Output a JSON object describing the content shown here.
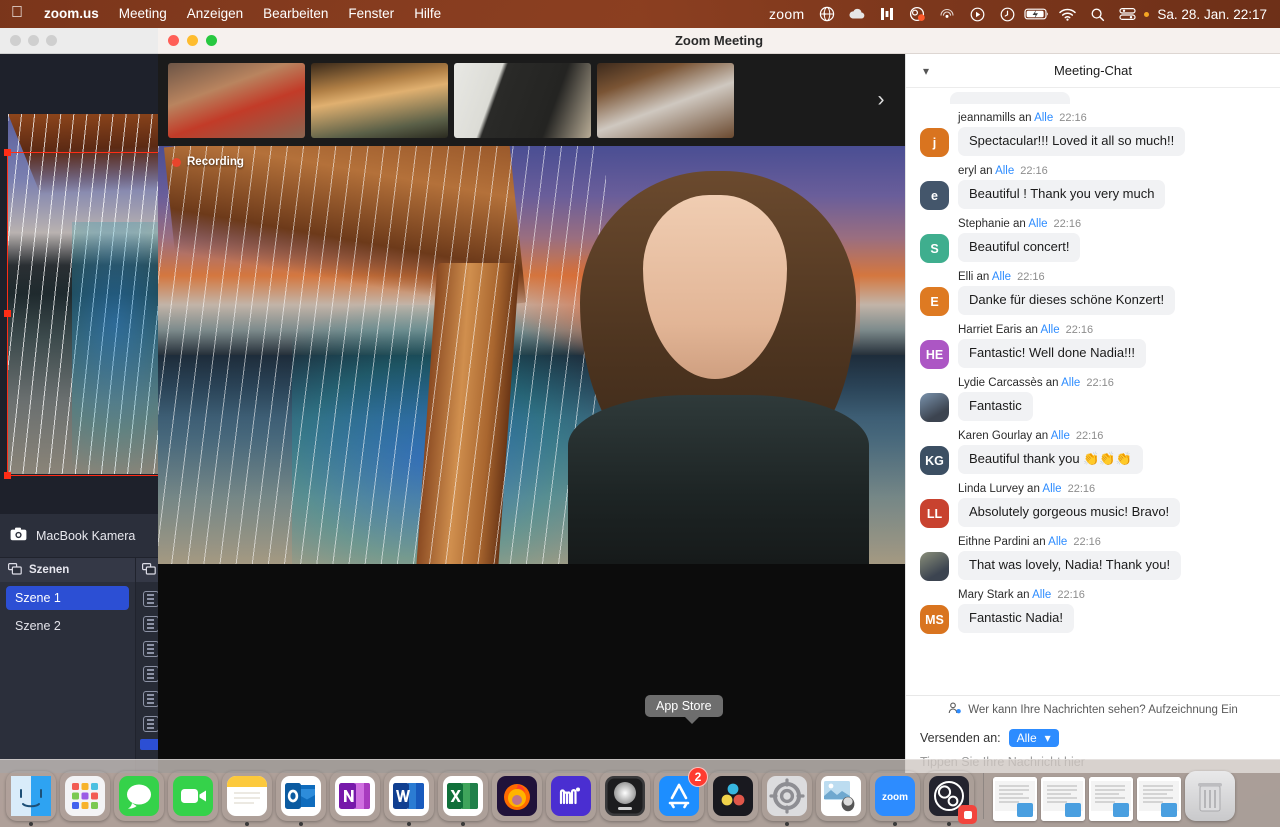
{
  "menubar": {
    "apple_icon": "apple-logo",
    "app_name": "zoom.us",
    "items": [
      "Meeting",
      "Anzeigen",
      "Bearbeiten",
      "Fenster",
      "Hilfe"
    ],
    "status_zoom_label": "zoom",
    "status_icons": [
      "globe-icon",
      "cloud-icon",
      "bars-icon",
      "obs-record-icon",
      "airplay-icon",
      "play-circle-icon",
      "clock-icon",
      "battery-charging-icon",
      "wifi-icon",
      "control-center-icon"
    ],
    "status_dot": "orange-dot",
    "search_icon": "search-icon",
    "clock": "Sa. 28. Jan.  22:17"
  },
  "obs_window": {
    "window_controls": [
      "close",
      "minimize",
      "zoom"
    ],
    "camera_source_label": "MacBook Kamera",
    "camera_icon": "camera-icon",
    "scenes_panel": {
      "title": "Szenen",
      "icon": "scenes-icon",
      "items": [
        {
          "label": "Szene 1",
          "selected": true
        },
        {
          "label": "Szene 2",
          "selected": false
        }
      ]
    },
    "sources_panel": {
      "icon": "sources-icon",
      "item_count": 6
    }
  },
  "zoom_window": {
    "title": "Zoom Meeting",
    "window_controls": [
      "close",
      "minimize",
      "zoom"
    ],
    "thumbnails": [
      {
        "name": "participant-thumb-1"
      },
      {
        "name": "participant-thumb-2"
      },
      {
        "name": "participant-thumb-3"
      },
      {
        "name": "participant-thumb-4"
      }
    ],
    "thumb_next_icon": "chevron-right-icon",
    "recording_label": "Recording",
    "speaker": {
      "name": "active-speaker-video",
      "description": "harpist"
    }
  },
  "chat": {
    "title": "Meeting-Chat",
    "collapse_icon": "chevron-down-icon",
    "to_word": "an",
    "messages": [
      {
        "sender": "jeannamills",
        "to": "Alle",
        "time": "22:16",
        "text": "Spectacular!!! Loved it all so much!!",
        "initials": "j",
        "color": "#d9741f",
        "photo": false
      },
      {
        "sender": "eryl",
        "to": "Alle",
        "time": "22:16",
        "text": "Beautiful ! Thank you very much",
        "initials": "e",
        "color": "#44566b",
        "photo": false
      },
      {
        "sender": "Stephanie",
        "to": "Alle",
        "time": "22:16",
        "text": "Beautiful concert!",
        "initials": "S",
        "color": "#3fae8e",
        "photo": false
      },
      {
        "sender": "Elli",
        "to": "Alle",
        "time": "22:16",
        "text": "Danke für dieses schöne Konzert!",
        "initials": "E",
        "color": "#de7a22",
        "photo": false
      },
      {
        "sender": "Harriet Earis",
        "to": "Alle",
        "time": "22:16",
        "text": "Fantastic! Well done Nadia!!!",
        "initials": "HE",
        "color": "#ac56c4",
        "photo": false
      },
      {
        "sender": "Lydie Carcassès",
        "to": "Alle",
        "time": "22:16",
        "text": "Fantastic",
        "initials": "",
        "color": "#7a93ad",
        "photo": true
      },
      {
        "sender": "Karen Gourlay",
        "to": "Alle",
        "time": "22:16",
        "text": "Beautiful thank you 👏👏👏",
        "initials": "KG",
        "color": "#3c4f63",
        "photo": false
      },
      {
        "sender": "Linda Lurvey",
        "to": "Alle",
        "time": "22:16",
        "text": "Absolutely gorgeous music! Bravo!",
        "initials": "LL",
        "color": "#c8422f",
        "photo": false
      },
      {
        "sender": "Eithne Pardini",
        "to": "Alle",
        "time": "22:16",
        "text": "That was lovely, Nadia! Thank you!",
        "initials": "",
        "color": "#8a8f7a",
        "photo": true
      },
      {
        "sender": "Mary Stark",
        "to": "Alle",
        "time": "22:16",
        "text": "Fantastic Nadia!",
        "initials": "MS",
        "color": "#d9741f",
        "photo": false
      }
    ],
    "notice_icon": "person-privacy-icon",
    "notice": "Wer kann Ihre Nachrichten sehen? Aufzeichnung Ein",
    "send_to_label": "Versenden an:",
    "send_to_value": "Alle",
    "send_to_caret": "caret-down-icon",
    "input_placeholder": "Tippen Sie Ihre Nachricht hier"
  },
  "dock": {
    "tooltip": "App Store",
    "items": [
      {
        "name": "finder",
        "label": "Finder",
        "kind": "finder",
        "running": true,
        "badge": null
      },
      {
        "name": "launchpad",
        "label": "Launchpad",
        "kind": "launchpad",
        "running": false,
        "badge": null
      },
      {
        "name": "messages",
        "label": "Nachrichten",
        "kind": "messages",
        "running": false,
        "badge": null
      },
      {
        "name": "facetime",
        "label": "FaceTime",
        "kind": "facetime",
        "running": false,
        "badge": null
      },
      {
        "name": "notes",
        "label": "Notizen",
        "kind": "notes",
        "running": true,
        "badge": null
      },
      {
        "name": "outlook",
        "label": "Outlook",
        "kind": "outlook",
        "running": true,
        "badge": null
      },
      {
        "name": "onenote",
        "label": "OneNote",
        "kind": "onenote",
        "running": false,
        "badge": null
      },
      {
        "name": "word",
        "label": "Word",
        "kind": "word",
        "running": true,
        "badge": null
      },
      {
        "name": "excel",
        "label": "Excel",
        "kind": "excel",
        "running": true,
        "badge": null
      },
      {
        "name": "firefox",
        "label": "Firefox",
        "kind": "firefox",
        "running": false,
        "badge": null
      },
      {
        "name": "musescore",
        "label": "MuseScore",
        "kind": "muse",
        "running": false,
        "badge": null
      },
      {
        "name": "logic-pro",
        "label": "Logic Pro",
        "kind": "logic",
        "running": false,
        "badge": null
      },
      {
        "name": "app-store",
        "label": "App Store",
        "kind": "appstore",
        "running": false,
        "badge": "2"
      },
      {
        "name": "davinci-resolve",
        "label": "DaVinci Resolve",
        "kind": "davinci",
        "running": false,
        "badge": null
      },
      {
        "name": "system-settings",
        "label": "Systemeinstellungen",
        "kind": "settings",
        "running": true,
        "badge": null
      },
      {
        "name": "preview",
        "label": "Vorschau",
        "kind": "preview",
        "running": false,
        "badge": null
      },
      {
        "name": "zoom",
        "label": "zoom",
        "kind": "zoom",
        "running": true,
        "badge": null
      },
      {
        "name": "obs",
        "label": "OBS",
        "kind": "obs",
        "running": true,
        "badge": "recording"
      }
    ],
    "minimized": [
      {
        "name": "minimized-window-1"
      },
      {
        "name": "minimized-window-2"
      },
      {
        "name": "minimized-window-3"
      },
      {
        "name": "minimized-window-4"
      }
    ],
    "trash_label": "Papierkorb"
  }
}
